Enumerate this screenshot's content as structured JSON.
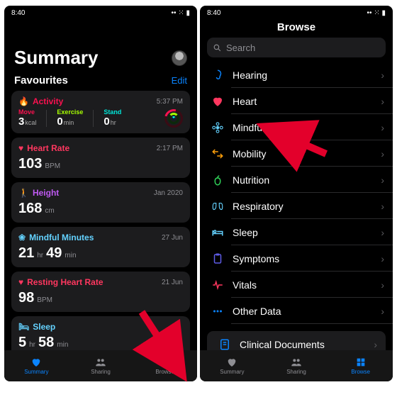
{
  "status_time": "8:40",
  "left": {
    "title": "Summary",
    "favourites_label": "Favourites",
    "edit_label": "Edit",
    "activity": {
      "title": "Activity",
      "color": "#fa114f",
      "time": "5:37 PM",
      "move": {
        "label": "Move",
        "value": "3",
        "unit": "kcal",
        "color": "#fa114f"
      },
      "exercise": {
        "label": "Exercise",
        "value": "0",
        "unit": "min",
        "color": "#a6ff00"
      },
      "stand": {
        "label": "Stand",
        "value": "0",
        "unit": "hr",
        "color": "#00e6d8"
      }
    },
    "heart_rate": {
      "title": "Heart Rate",
      "color": "#ff375f",
      "time": "2:17 PM",
      "value": "103",
      "unit": "BPM"
    },
    "height": {
      "title": "Height",
      "color": "#bf5af2",
      "time": "Jan 2020",
      "value": "168",
      "unit": "cm"
    },
    "mindful": {
      "title": "Mindful Minutes",
      "color": "#64d2ff",
      "time": "27 Jun",
      "h": "21",
      "hu": "hr",
      "m": "49",
      "mu": "min"
    },
    "resting": {
      "title": "Resting Heart Rate",
      "color": "#ff375f",
      "time": "21 Jun",
      "value": "98",
      "unit": "BPM"
    },
    "sleep": {
      "title": "Sleep",
      "color": "#64d2ff",
      "h": "5",
      "hu": "hr",
      "m": "58",
      "mu": "min"
    },
    "tabs": {
      "summary": "Summary",
      "sharing": "Sharing",
      "browse": "Browse"
    }
  },
  "right": {
    "title": "Browse",
    "search_placeholder": "Search",
    "rows": [
      {
        "name": "hearing",
        "label": "Hearing",
        "color": "#0a84ff",
        "icon": "ear"
      },
      {
        "name": "heart",
        "label": "Heart",
        "color": "#ff375f",
        "icon": "heart"
      },
      {
        "name": "mindfulness",
        "label": "Mindfulness",
        "color": "#64d2ff",
        "icon": "flower"
      },
      {
        "name": "mobility",
        "label": "Mobility",
        "color": "#ff9f0a",
        "icon": "arrows"
      },
      {
        "name": "nutrition",
        "label": "Nutrition",
        "color": "#30d158",
        "icon": "apple"
      },
      {
        "name": "respiratory",
        "label": "Respiratory",
        "color": "#64d2ff",
        "icon": "lungs"
      },
      {
        "name": "sleep",
        "label": "Sleep",
        "color": "#64d2ff",
        "icon": "bed"
      },
      {
        "name": "symptoms",
        "label": "Symptoms",
        "color": "#5e5ce6",
        "icon": "clipboard"
      },
      {
        "name": "vitals",
        "label": "Vitals",
        "color": "#ff375f",
        "icon": "ecg"
      },
      {
        "name": "other-data",
        "label": "Other Data",
        "color": "#0a84ff",
        "icon": "dots"
      }
    ],
    "clinical": {
      "label": "Clinical Documents",
      "color": "#0a84ff"
    },
    "tabs": {
      "summary": "Summary",
      "sharing": "Sharing",
      "browse": "Browse"
    }
  }
}
